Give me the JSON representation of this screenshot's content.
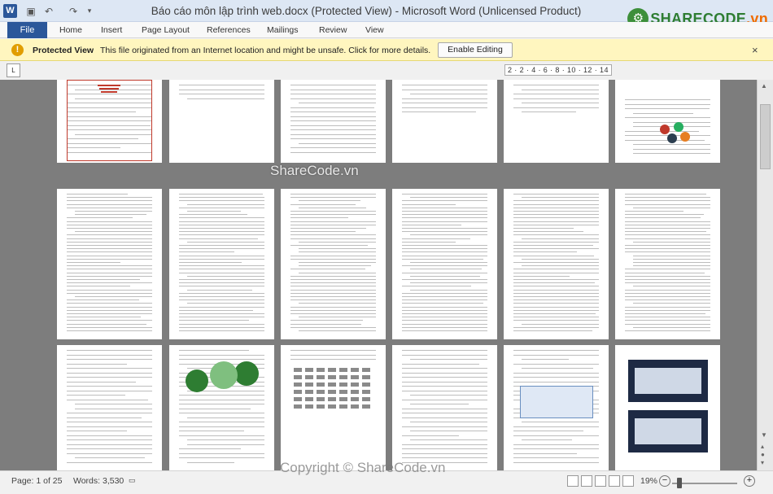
{
  "window": {
    "title": "Báo cáo môn lập trình web.docx (Protected View) - Microsoft Word (Unlicensed Product)",
    "app_icon": "word-icon",
    "quick_access": [
      "save-icon",
      "undo-icon",
      "redo-icon",
      "customize-icon"
    ]
  },
  "watermark": {
    "logo_text": "SHARECODE",
    "logo_suffix": ".vn",
    "center": "ShareCode.vn",
    "bottom": "Copyright © ShareCode.vn"
  },
  "ribbon": {
    "file": "File",
    "tabs": [
      "Home",
      "Insert",
      "Page Layout",
      "References",
      "Mailings",
      "Review",
      "View"
    ]
  },
  "protected": {
    "title": "Protected View",
    "message": "This file originated from an Internet location and might be unsafe. Click for more details.",
    "button": "Enable Editing",
    "close": "×"
  },
  "ruler": {
    "corner": "L",
    "numbers": "2 · 2 · 4 · 6 · 8 · 10 · 12 · 14"
  },
  "status": {
    "page": "Page: 1 of 25",
    "words": "Words: 3,530",
    "zoom": "19%",
    "zoom_out": "−",
    "zoom_in": "+"
  },
  "colors": {
    "accent": "#2b579a",
    "doc_bg": "#7d7d7d",
    "protected_bar": "#fff6bf"
  }
}
